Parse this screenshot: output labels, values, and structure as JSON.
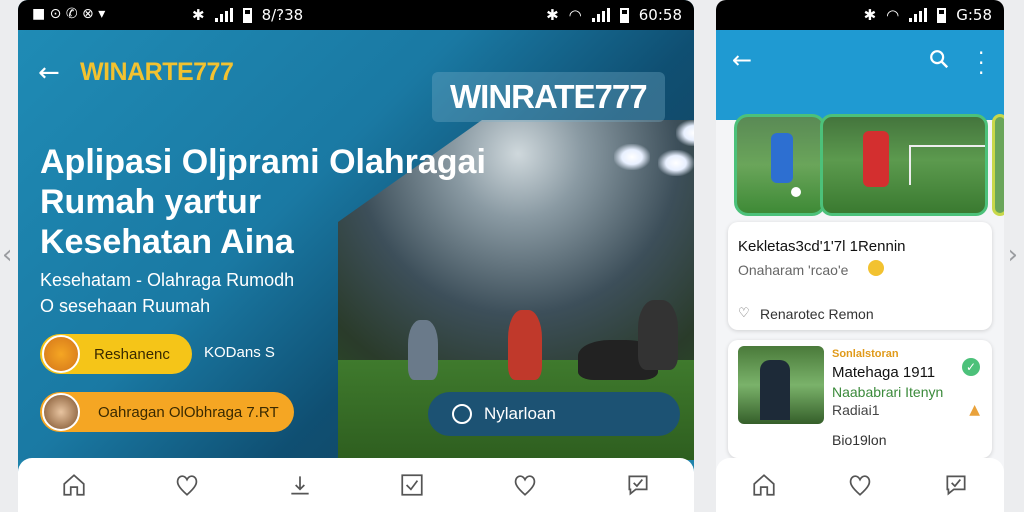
{
  "nav_arrows": {
    "left": "‹",
    "right": "›"
  },
  "phone_a": {
    "status": {
      "time": "8/?38",
      "left_icons": "■ ⊙ ✆ ⊗ ▾",
      "right_time": "60:58"
    },
    "brand_small": "WINARTE777",
    "brand_large": "WINRATE777",
    "headline": [
      "Aplipasi Oljprami Olahragai",
      "Rumah yartur",
      "Kesehatan Aina"
    ],
    "subtitle_1": "Kesehatam - Olahraga Rumodh",
    "subtitle_2": "O sesehaan Ruumah",
    "pill_1": "Reshanenc",
    "pill_1_right": "KODans S",
    "pill_2": "Oahragan OlObhraga 7.RT",
    "action_button": "Nylarloan",
    "colors": {
      "accent_yellow": "#f2c230",
      "pill_orange": "#f5a623",
      "button_dark": "#1c5273"
    }
  },
  "phone_b": {
    "status": {
      "time": "G:58"
    },
    "card_1": {
      "title": "Kekletas3cd'1'7l 1Rennin",
      "sub": "Onaharam 'rcao'e",
      "footer": "Renarotec Remon"
    },
    "card_2": {
      "kicker": "Sonlalstoran",
      "title": "Matehaga 1911",
      "line_2": "Naababrari Itenyn",
      "line_3": "Radiai1",
      "footer": "Bio19lon"
    },
    "colors": {
      "header_blue": "#1f9ad2",
      "green": "#4cc17a"
    }
  },
  "bottom_nav_icons": [
    "home-icon",
    "heart-icon",
    "upload-icon",
    "checkbox-icon",
    "heart-icon",
    "chat-icon"
  ]
}
